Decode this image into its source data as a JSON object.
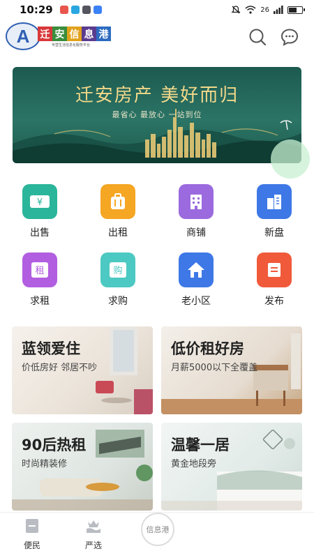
{
  "status_bar": {
    "time": "10:29",
    "network": "26",
    "battery_level": 0.65,
    "app_icon_colors": [
      "#e8554d",
      "#2aa7e0",
      "#55555f",
      "#3b82f6"
    ]
  },
  "header": {
    "logo": {
      "letter": "A",
      "chars": [
        "迁",
        "安",
        "信",
        "息",
        "港"
      ],
      "char_colors": [
        "#d9383a",
        "#3a8e3d",
        "#e2a21c",
        "#5a3c8f",
        "#2d6bc0"
      ],
      "tagline": "专营生活信息化服务平台"
    },
    "search_icon": "search-icon",
    "chat_icon": "chat-bubble-icon"
  },
  "banner": {
    "title": "迁安房产 美好而归",
    "subtitle": "最省心 最放心 一站到位"
  },
  "categories": [
    {
      "label": "出售",
      "glyph": "¥",
      "color": "#2bb59a",
      "icon": "ticket-yen-icon"
    },
    {
      "label": "出租",
      "glyph": "",
      "color": "#f5a623",
      "icon": "suitcase-icon"
    },
    {
      "label": "商铺",
      "glyph": "",
      "color": "#9b6ade",
      "icon": "shop-building-icon"
    },
    {
      "label": "新盘",
      "glyph": "",
      "color": "#3d78e6",
      "icon": "building-icon"
    },
    {
      "label": "求租",
      "glyph": "租",
      "color": "#b25ee0",
      "icon": "rent-request-icon"
    },
    {
      "label": "求购",
      "glyph": "购",
      "color": "#4cc9c2",
      "icon": "buy-request-icon"
    },
    {
      "label": "老小区",
      "glyph": "",
      "color": "#3d78e6",
      "icon": "house-icon"
    },
    {
      "label": "发布",
      "glyph": "",
      "color": "#f05a3a",
      "icon": "publish-document-icon"
    }
  ],
  "cards": [
    {
      "title": "蓝领爱住",
      "subtitle": "价低房好 邻居不吵"
    },
    {
      "title": "低价租好房",
      "subtitle": "月薪5000以下全覆盖"
    },
    {
      "title": "90后热租",
      "subtitle": "时尚精装修"
    },
    {
      "title": "温馨一居",
      "subtitle": "黄金地段旁"
    }
  ],
  "bottom_nav": {
    "items": [
      {
        "label": "便民",
        "icon": "convenience-icon"
      },
      {
        "label": "严选",
        "icon": "crown-hand-icon"
      }
    ],
    "center_label": "信息港"
  }
}
